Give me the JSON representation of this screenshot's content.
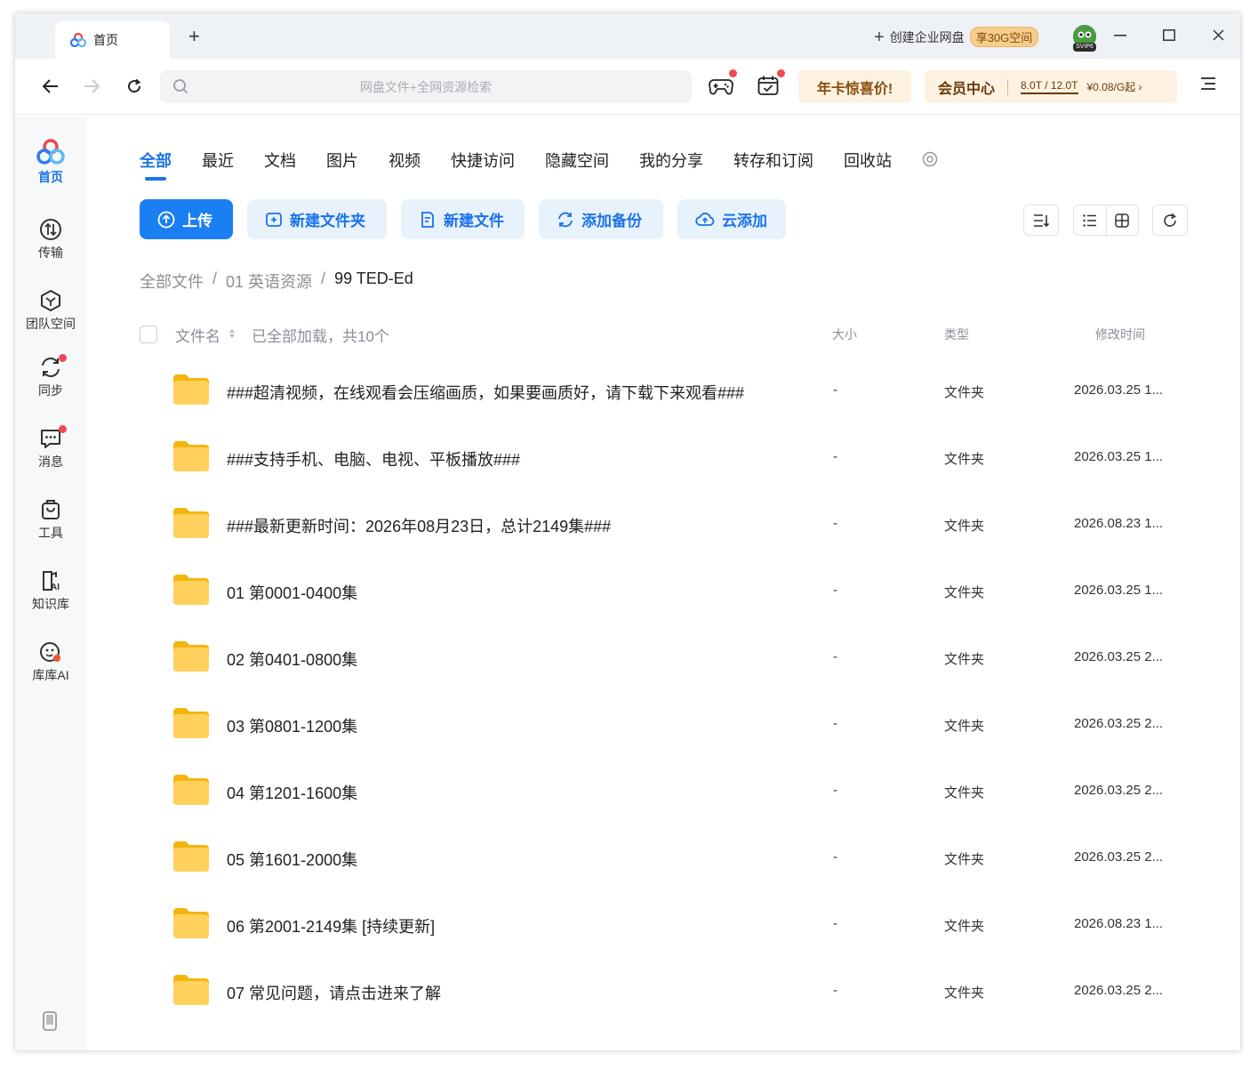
{
  "titlebar": {
    "tab_label": "首页",
    "newtab_label": "+",
    "enterprise_label": "创建企业网盘",
    "enterprise_badge": "享30G空间",
    "avatar_level": "SVIP6"
  },
  "navrow": {
    "search_placeholder": "网盘文件+全网资源检索",
    "promo_label": "年卡惊喜价!",
    "vip_label": "会员中心",
    "vip_quota": "8.0T / 12.0T",
    "vip_price": "¥0.08/G起 ›"
  },
  "sidebar": {
    "items": [
      {
        "label": "首页",
        "icon": "baidu-logo-icon"
      },
      {
        "label": "传输",
        "icon": "transfer-icon"
      },
      {
        "label": "团队空间",
        "icon": "team-space-icon"
      },
      {
        "label": "同步",
        "icon": "sync-icon"
      },
      {
        "label": "消息",
        "icon": "message-icon"
      },
      {
        "label": "工具",
        "icon": "tools-icon"
      },
      {
        "label": "知识库",
        "icon": "knowledge-base-icon"
      },
      {
        "label": "库库AI",
        "icon": "kuku-ai-icon"
      }
    ]
  },
  "categories": [
    "全部",
    "最近",
    "文档",
    "图片",
    "视频",
    "快捷访问",
    "隐藏空间",
    "我的分享",
    "转存和订阅",
    "回收站"
  ],
  "actions": {
    "upload": "上传",
    "new_folder": "新建文件夹",
    "new_file": "新建文件",
    "add_backup": "添加备份",
    "cloud_add": "云添加"
  },
  "breadcrumb": [
    "全部文件",
    "/",
    "01 英语资源",
    "/",
    "99 TED-Ed"
  ],
  "table": {
    "col_name": "文件名",
    "loaded_info": "已全部加载，共10个",
    "col_size": "大小",
    "col_type": "类型",
    "col_modified": "修改时间",
    "rows": [
      {
        "name": "###超清视频，在线观看会压缩画质，如果要画质好，请下载下来观看###",
        "size": "-",
        "type": "文件夹",
        "date": "2026.03.25 1..."
      },
      {
        "name": "###支持手机、电脑、电视、平板播放###",
        "size": "-",
        "type": "文件夹",
        "date": "2026.03.25 1..."
      },
      {
        "name": "###最新更新时间：2026年08月23日，总计2149集###",
        "size": "-",
        "type": "文件夹",
        "date": "2026.08.23 1..."
      },
      {
        "name": "01 第0001-0400集",
        "size": "-",
        "type": "文件夹",
        "date": "2026.03.25 1..."
      },
      {
        "name": "02 第0401-0800集",
        "size": "-",
        "type": "文件夹",
        "date": "2026.03.25 2..."
      },
      {
        "name": "03 第0801-1200集",
        "size": "-",
        "type": "文件夹",
        "date": "2026.03.25 2..."
      },
      {
        "name": "04 第1201-1600集",
        "size": "-",
        "type": "文件夹",
        "date": "2026.03.25 2..."
      },
      {
        "name": "05 第1601-2000集",
        "size": "-",
        "type": "文件夹",
        "date": "2026.03.25 2..."
      },
      {
        "name": "06 第2001-2149集 [持续更新]",
        "size": "-",
        "type": "文件夹",
        "date": "2026.08.23 1..."
      },
      {
        "name": "07 常见问题，请点击进来了解",
        "size": "-",
        "type": "文件夹",
        "date": "2026.03.25 2..."
      }
    ]
  },
  "colors": {
    "accent": "#1a73e8",
    "primary_button": "#1a7ff2",
    "folder": "#ffc83d",
    "notification_dot": "#f04854"
  }
}
